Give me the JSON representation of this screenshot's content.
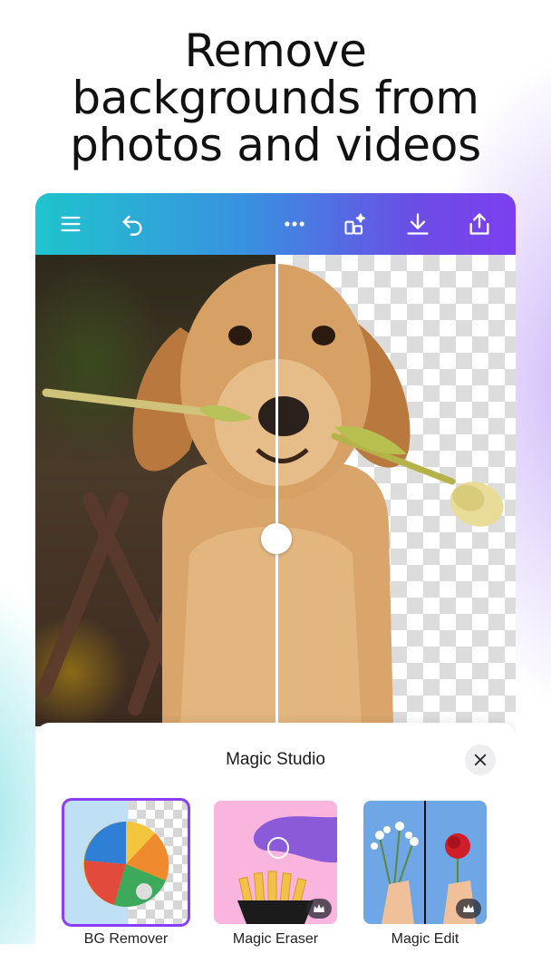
{
  "headline": {
    "line1": "Remove",
    "line2": "backgrounds from",
    "line3": "photos and videos"
  },
  "toolbar": {
    "icons": [
      "menu-icon",
      "undo-icon",
      "more-icon",
      "magic-resize-icon",
      "download-icon",
      "share-icon"
    ]
  },
  "canvas": {
    "subject": "dog holding flower",
    "comparison_split": 0.5
  },
  "magic_studio": {
    "title": "Magic Studio",
    "tools": [
      {
        "label": "BG Remover",
        "selected": true,
        "premium": false
      },
      {
        "label": "Magic Eraser",
        "selected": false,
        "premium": true
      },
      {
        "label": "Magic Edit",
        "selected": false,
        "premium": true
      }
    ]
  },
  "colors": {
    "toolbar_start": "#1fc4cc",
    "toolbar_end": "#7b3ff0",
    "accent": "#8b3dff"
  }
}
